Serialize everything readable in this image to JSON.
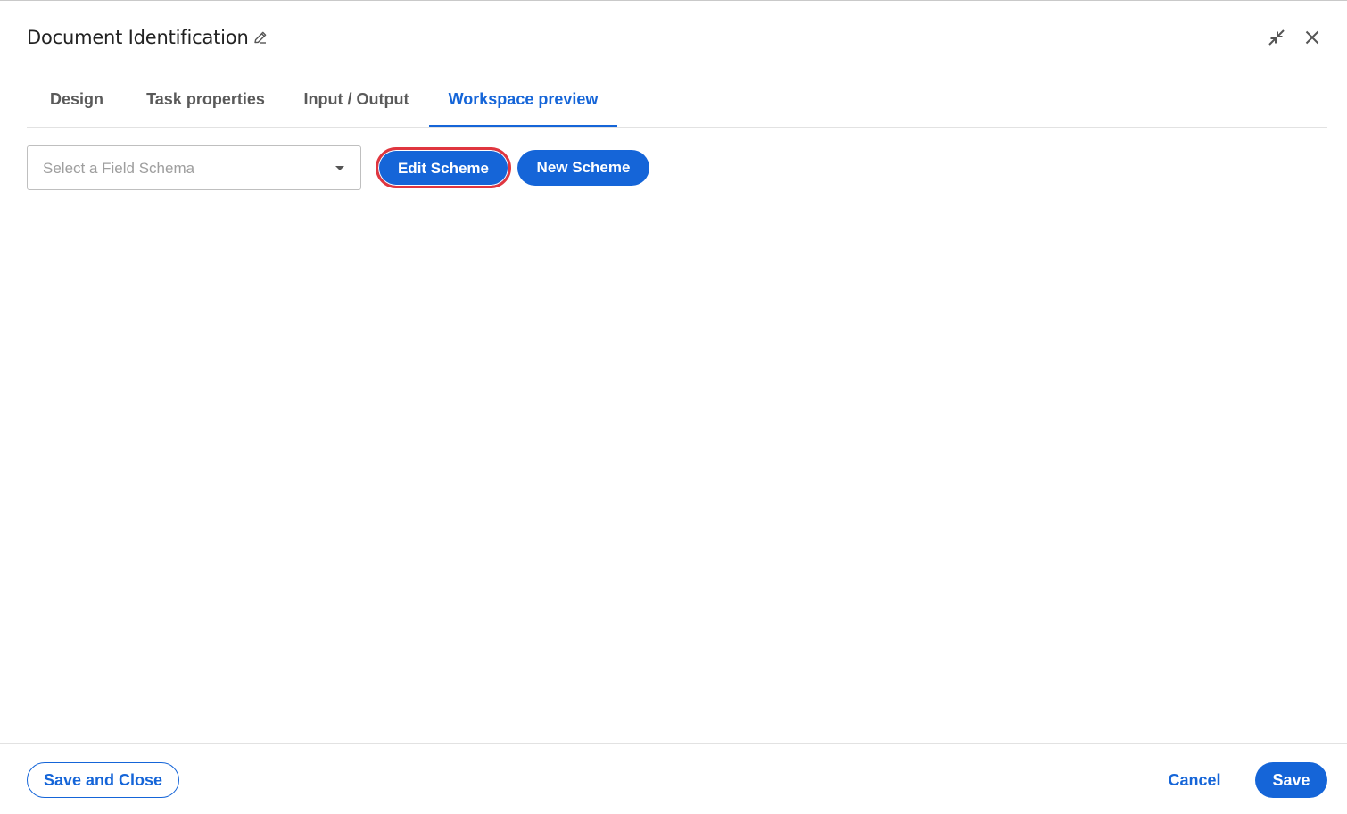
{
  "header": {
    "title": "Document Identification",
    "title_edit_icon": "pencil-icon",
    "collapse_icon": "collapse-icon",
    "close_icon": "close-icon"
  },
  "tabs": [
    {
      "label": "Design",
      "active": false
    },
    {
      "label": "Task properties",
      "active": false
    },
    {
      "label": "Input / Output",
      "active": false
    },
    {
      "label": "Workspace preview",
      "active": true
    }
  ],
  "toolbar": {
    "schema_select": {
      "placeholder": "Select a Field Schema",
      "value": ""
    },
    "edit_scheme_label": "Edit Scheme",
    "new_scheme_label": "New Scheme"
  },
  "footer": {
    "save_and_close_label": "Save and Close",
    "cancel_label": "Cancel",
    "save_label": "Save"
  },
  "colors": {
    "accent": "#1565d8",
    "highlight_outline": "#e0363f",
    "tab_inactive": "#5a5a5a"
  }
}
